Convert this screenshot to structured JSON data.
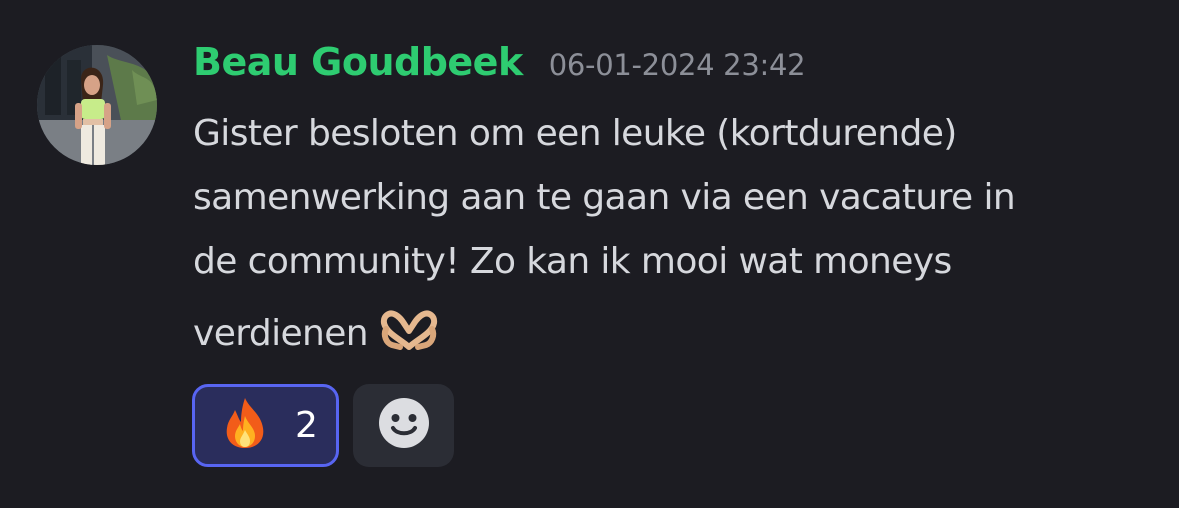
{
  "message": {
    "author": "Beau Goudbeek",
    "timestamp": "06-01-2024 23:42",
    "author_color": "#2ecc71",
    "content_lines": [
      "Gister besloten om een leuke (kortdurende)",
      "samenwerking aan te gaan via een vacature in",
      "de community! Zo kan ik mooi wat moneys",
      "verdienen"
    ],
    "inline_emoji": "heart-hands-icon"
  },
  "reactions": [
    {
      "emoji": "fire-icon",
      "count": "2",
      "active": true
    }
  ],
  "add_reaction": {
    "icon": "smiley-add-reaction-icon"
  },
  "colors": {
    "background": "#1c1c22",
    "accent": "#5865f2",
    "reaction_bg": "#2a2d5c",
    "text": "#d6d8dd",
    "muted": "#8c8f98"
  }
}
